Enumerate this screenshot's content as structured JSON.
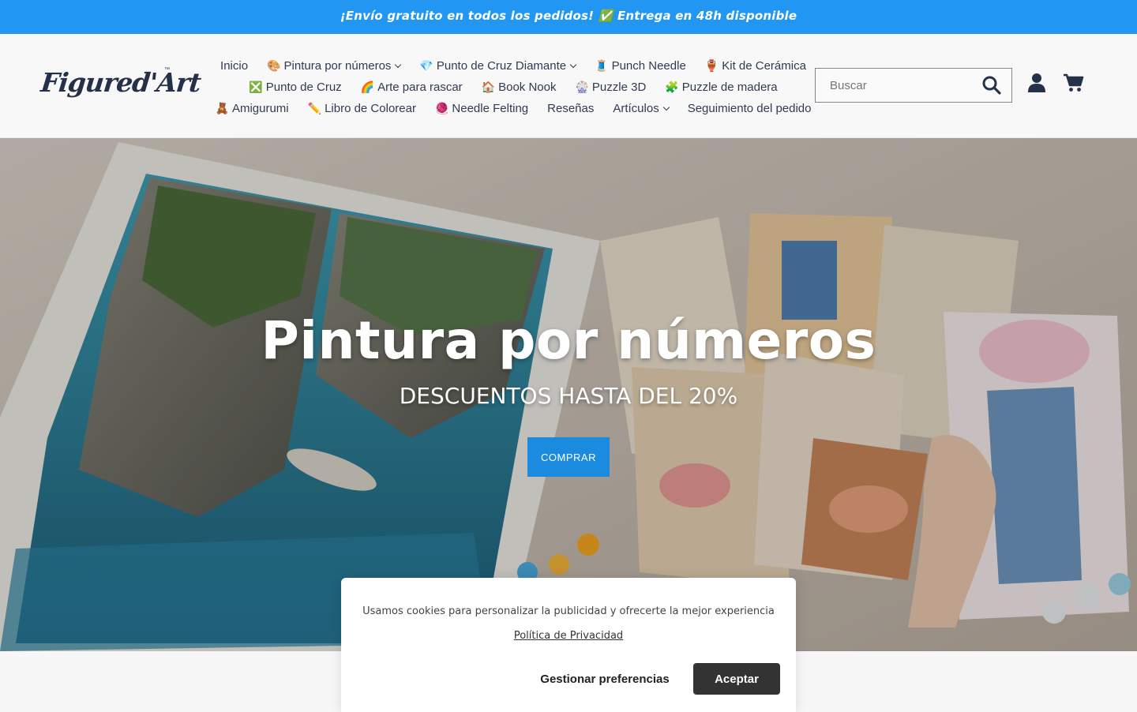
{
  "announcement": {
    "text": "¡Envío gratuito en todos los pedidos! ✅ Entrega en 48h disponible"
  },
  "header": {
    "logo_text": "Figured'Art",
    "logo_tm": "™",
    "search_placeholder": "Buscar"
  },
  "nav": {
    "row1": [
      {
        "emoji": "",
        "label": "Inicio",
        "dropdown": false
      },
      {
        "emoji": "🎨",
        "label": "Pintura por números",
        "dropdown": true
      },
      {
        "emoji": "💎",
        "label": "Punto de Cruz Diamante",
        "dropdown": true
      },
      {
        "emoji": "🧵",
        "label": "Punch Needle",
        "dropdown": false
      },
      {
        "emoji": "🏺",
        "label": "Kit de Cerámica",
        "dropdown": false
      }
    ],
    "row2": [
      {
        "emoji": "❎",
        "label": "Punto de Cruz",
        "dropdown": false
      },
      {
        "emoji": "🌈",
        "label": "Arte para rascar",
        "dropdown": false
      },
      {
        "emoji": "🏠",
        "label": "Book Nook",
        "dropdown": false
      },
      {
        "emoji": "🎡",
        "label": "Puzzle 3D",
        "dropdown": false
      },
      {
        "emoji": "🧩",
        "label": "Puzzle de madera",
        "dropdown": false
      }
    ],
    "row3": [
      {
        "emoji": "🧸",
        "label": "Amigurumi",
        "dropdown": false
      },
      {
        "emoji": "✏️",
        "label": "Libro de Colorear",
        "dropdown": false
      },
      {
        "emoji": "🧶",
        "label": "Needle Felting",
        "dropdown": false
      },
      {
        "emoji": "",
        "label": "Reseñas",
        "dropdown": false
      },
      {
        "emoji": "",
        "label": "Artículos",
        "dropdown": true
      },
      {
        "emoji": "",
        "label": "Seguimiento del pedido",
        "dropdown": false
      }
    ]
  },
  "hero": {
    "title": "Pintura por números",
    "subtitle": "DESCUENTOS HASTA DEL 20%",
    "button": "COMPRAR"
  },
  "cookie": {
    "text": "Usamos cookies para personalizar la publicidad y ofrecerte la mejor experiencia",
    "link": "Política de Privacidad",
    "manage": "Gestionar preferencias",
    "accept": "Aceptar"
  },
  "colors": {
    "announcement_bg": "#2196f3",
    "brand_navy": "#243149",
    "cta_blue": "#1b8be0",
    "accept_bg": "#333333"
  },
  "icons": [
    "search-icon",
    "account-icon",
    "cart-icon"
  ]
}
